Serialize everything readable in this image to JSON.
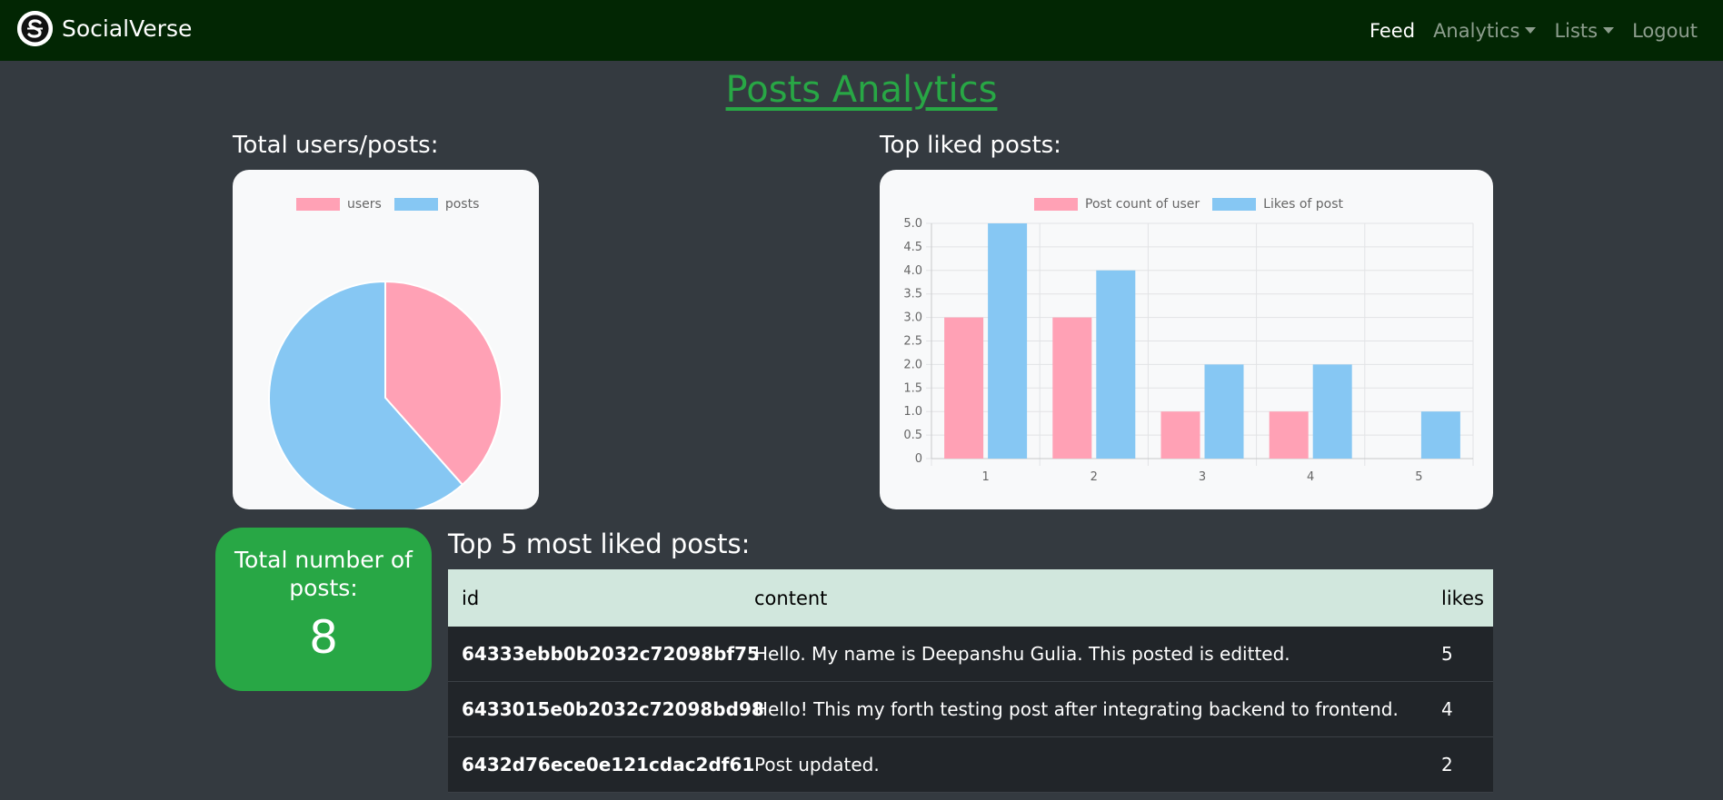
{
  "navbar": {
    "brand": "SocialVerse",
    "links": [
      {
        "label": "Feed",
        "active": true,
        "dropdown": false
      },
      {
        "label": "Analytics",
        "active": false,
        "dropdown": true
      },
      {
        "label": "Lists",
        "active": false,
        "dropdown": true
      },
      {
        "label": "Logout",
        "active": false,
        "dropdown": false
      }
    ]
  },
  "page": {
    "title": "Posts Analytics",
    "pie_section_title": "Total users/posts:",
    "bar_section_title": "Top liked posts:",
    "table_section_title": "Top 5 most liked posts:"
  },
  "kpi": {
    "label": "Total number of posts:",
    "value": "8"
  },
  "colors": {
    "pink": "#ffa1b5",
    "blue": "#86c7f3",
    "green": "#28a745",
    "nav_bg": "#022603",
    "page_bg": "#343a40"
  },
  "chart_data": [
    {
      "type": "pie",
      "legend": [
        "users",
        "posts"
      ],
      "values": [
        5,
        8
      ],
      "colors": [
        "#ffa1b5",
        "#86c7f3"
      ],
      "legend_position": "top"
    },
    {
      "type": "bar",
      "categories": [
        "1",
        "2",
        "3",
        "4",
        "5"
      ],
      "series": [
        {
          "name": "Post count of user",
          "values": [
            3,
            3,
            1,
            1,
            0
          ],
          "color": "#ffa1b5"
        },
        {
          "name": "Likes of post",
          "values": [
            5,
            4,
            2,
            2,
            1
          ],
          "color": "#86c7f3"
        }
      ],
      "ylim": [
        0,
        5
      ],
      "yticks": [
        "0",
        "0.5",
        "1.0",
        "1.5",
        "2.0",
        "2.5",
        "3.0",
        "3.5",
        "4.0",
        "4.5",
        "5.0"
      ],
      "grid": true,
      "legend_position": "top"
    }
  ],
  "table": {
    "headers": [
      "id",
      "content",
      "likes"
    ],
    "rows": [
      {
        "id": "64333ebb0b2032c72098bf75",
        "content": "Hello. My name is Deepanshu Gulia. This posted is editted.",
        "likes": "5"
      },
      {
        "id": "6433015e0b2032c72098bd98",
        "content": "Hello! This my forth testing post after integrating backend to frontend.",
        "likes": "4"
      },
      {
        "id": "6432d76ece0e121cdac2df61",
        "content": "Post updated.",
        "likes": "2"
      }
    ]
  }
}
